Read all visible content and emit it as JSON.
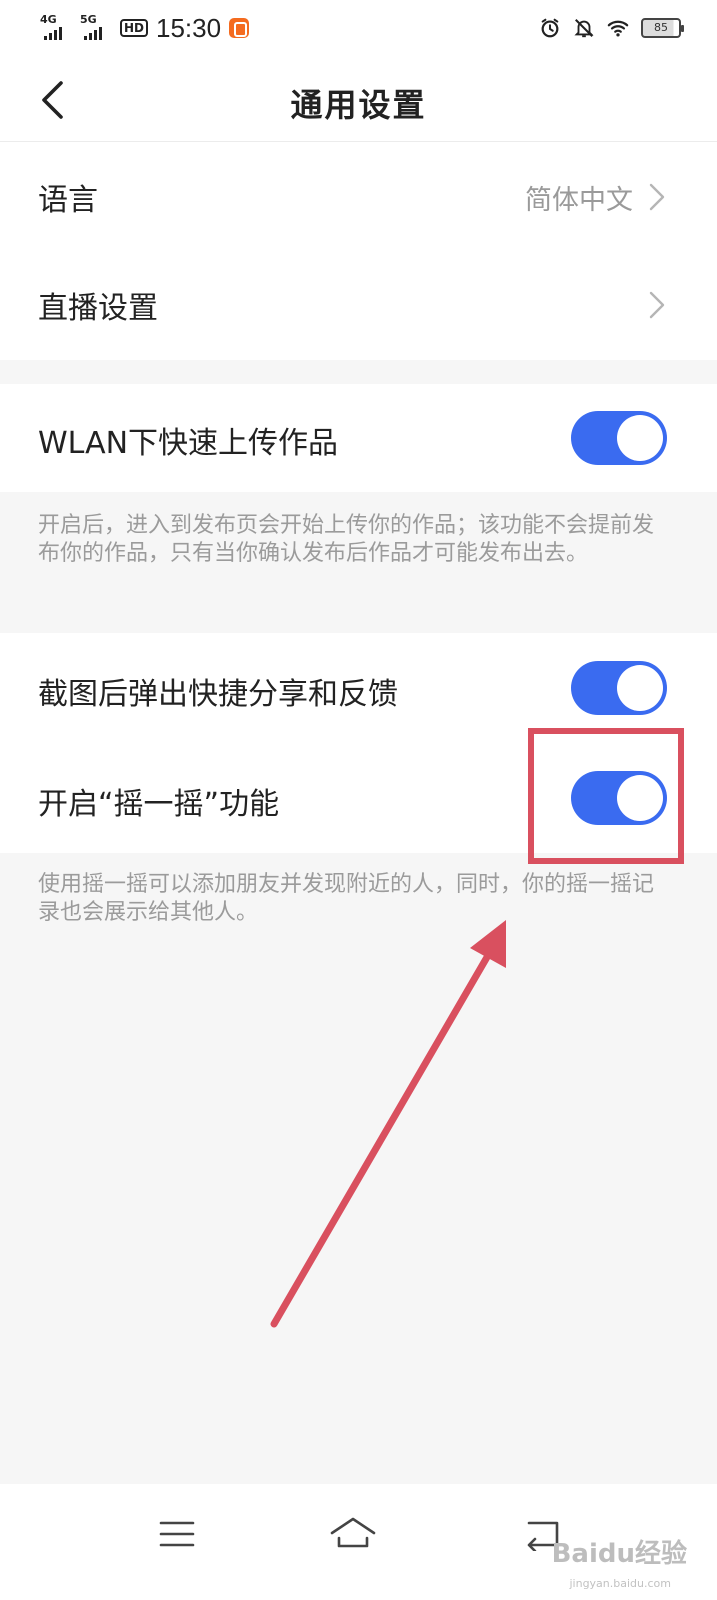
{
  "status_bar": {
    "network_1": "4G",
    "network_2": "5G",
    "hd_badge": "HD",
    "time": "15:30",
    "battery_level": "85",
    "icons": [
      "signal-icon",
      "signal-icon",
      "hd-voice-icon",
      "kuaishou-app-icon",
      "alarm-icon",
      "mute-icon",
      "wifi-icon",
      "battery-icon"
    ]
  },
  "header": {
    "title": "通用设置",
    "back_icon": "chevron-left-icon"
  },
  "settings": {
    "language": {
      "label": "语言",
      "value": "简体中文"
    },
    "live": {
      "label": "直播设置"
    },
    "wlan_upload": {
      "label": "WLAN下快速上传作品",
      "enabled": true,
      "description": "开启后，进入到发布页会开始上传你的作品；该功能不会提前发布你的作品，只有当你确认发布后作品才可能发布出去。"
    },
    "screenshot_share": {
      "label": "截图后弹出快捷分享和反馈",
      "enabled": true
    },
    "shake": {
      "label": "开启“摇一摇”功能",
      "enabled": true,
      "description": "使用摇一摇可以添加朋友并发现附近的人，同时，你的摇一摇记录也会展示给其他人。"
    }
  },
  "colors": {
    "toggle_on": "#3a6bf0",
    "annotation": "#d9505f",
    "page_bg": "#f6f6f6"
  },
  "navbar": {
    "icons": [
      "menu-icon",
      "home-icon",
      "back-icon"
    ]
  },
  "watermark": {
    "text": "Baidu经验",
    "sub": "jingyan.baidu.com"
  }
}
